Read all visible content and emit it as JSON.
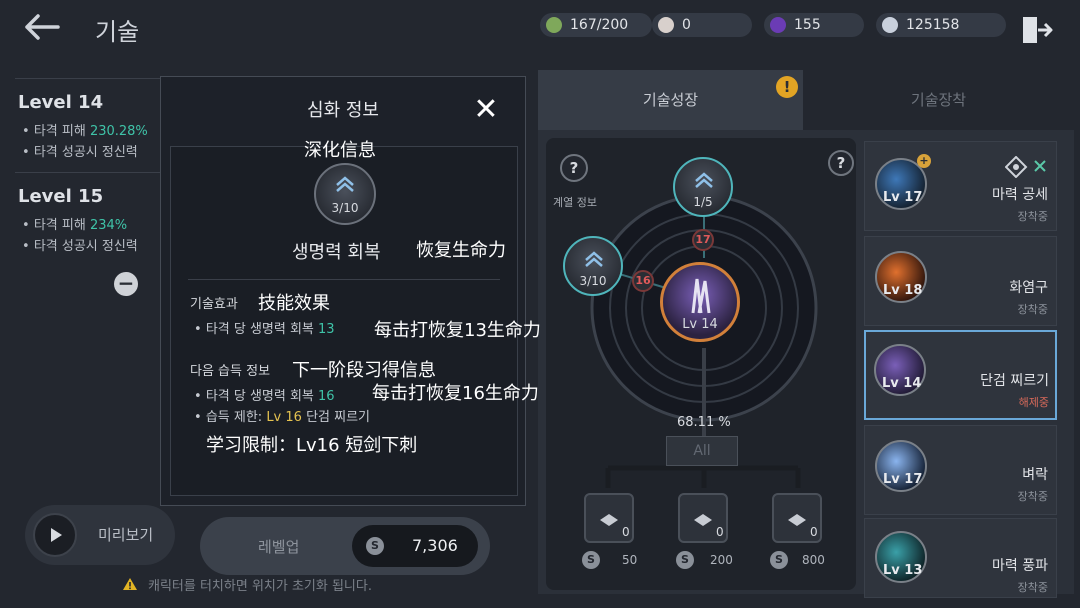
{
  "header": {
    "title": "기술",
    "resources": [
      {
        "icon": "energy-icon",
        "value": "167/200",
        "color": "#7fa85b"
      },
      {
        "icon": "pearl-icon",
        "value": "0",
        "color": "#d8d0cc"
      },
      {
        "icon": "purple-gem-icon",
        "value": "155",
        "color": "#6b3cb5"
      },
      {
        "icon": "silver-coin-icon",
        "value": "125158",
        "color": "#c9d0dc"
      }
    ]
  },
  "left": {
    "levels": [
      {
        "title": "Level 14",
        "lines": [
          {
            "label": "타격 피해",
            "value": "230.28%"
          },
          {
            "label": "타격 성공시 정신력",
            "value": ""
          }
        ]
      },
      {
        "title": "Level 15",
        "lines": [
          {
            "label": "타격 피해",
            "value": "234%"
          },
          {
            "label": "타격 성공시 정신력",
            "value": ""
          }
        ]
      }
    ],
    "preview_label": "미리보기",
    "levelup_label": "레벨업",
    "levelup_cost": "7,306",
    "warning": "캐릭터를 터치하면 위치가 초기화 됩니다."
  },
  "modal": {
    "title": "심화 정보",
    "title_cn": "深化信息",
    "orb_count": "3/10",
    "skill_name": "생명력 회복",
    "skill_name_cn": "恢复生命力",
    "effect_header": "기술효과",
    "effect_header_cn": "技能效果",
    "effect_label": "타격 당 생명력 회복",
    "effect_value": "13",
    "effect_cn": "每击打恢复13生命力",
    "next_header": "다음 습득 정보",
    "next_header_cn": "下一阶段习得信息",
    "next_label": "타격 당 생명력 회복",
    "next_value": "16",
    "next_cn": "每击打恢复16生命力",
    "req_label": "습득 제한:",
    "req_level": "Lv 16",
    "req_skill": "단검 찌르기",
    "req_cn": "学习限制：Lv16 短剑下刺"
  },
  "right": {
    "tabs": [
      {
        "label": "기술성장"
      },
      {
        "label": "기술장착"
      }
    ],
    "alert_badge": "!",
    "lineage_label": "계열 정보",
    "help_label": "?",
    "nodes": [
      {
        "label": "1/5"
      },
      {
        "label": "3/10"
      }
    ],
    "locks": [
      {
        "label": "17"
      },
      {
        "label": "16"
      }
    ],
    "center_level": "Lv 14",
    "percent": "68.11 %",
    "all_label": "All",
    "books": [
      {
        "count": "0",
        "cost": "50"
      },
      {
        "count": "0",
        "cost": "200"
      },
      {
        "count": "0",
        "cost": "800"
      }
    ]
  },
  "skills": [
    {
      "level": "Lv 17",
      "name": "마력 공세",
      "state": "장착중",
      "color": "#3e78b8"
    },
    {
      "level": "Lv 18",
      "name": "화염구",
      "state": "장착중",
      "color": "#c8542a"
    },
    {
      "level": "Lv 14",
      "name": "단검 찌르기",
      "state": "해제중",
      "color": "#6e52b8"
    },
    {
      "level": "Lv 17",
      "name": "벼락",
      "state": "장착중",
      "color": "#5b8fd0"
    },
    {
      "level": "Lv 13",
      "name": "마력 풍파",
      "state": "장착중",
      "color": "#3aa0a8"
    }
  ]
}
